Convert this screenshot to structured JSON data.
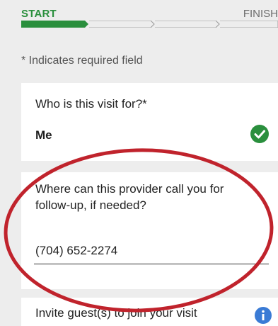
{
  "progress": {
    "start_label": "START",
    "finish_label": "FINISH"
  },
  "form": {
    "required_note": "* Indicates required field",
    "visit_for": {
      "question": "Who is this visit for?*",
      "answer": "Me"
    },
    "phone": {
      "question": "Where can this provider call you for follow-up, if needed?",
      "value": "(704) 652-2274"
    },
    "guest": {
      "question": "Invite guest(s) to join your visit"
    }
  },
  "colors": {
    "accent_green": "#2a8f3d",
    "annotation_red": "#c0232c"
  },
  "icons": {
    "check": "check-circle-icon",
    "info": "info-icon"
  }
}
